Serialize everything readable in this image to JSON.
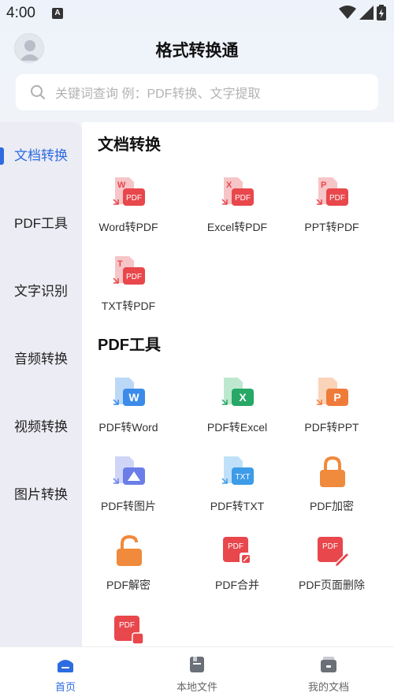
{
  "status_bar": {
    "time": "4:00",
    "notif_letter": "A"
  },
  "header": {
    "title": "格式转换通"
  },
  "search": {
    "placeholder": "关键词查询 例：PDF转换、文字提取"
  },
  "sidebar": {
    "items": [
      {
        "label": "文档转换",
        "active": true
      },
      {
        "label": "PDF工具",
        "active": false
      },
      {
        "label": "文字识别",
        "active": false
      },
      {
        "label": "音频转换",
        "active": false
      },
      {
        "label": "视频转换",
        "active": false
      },
      {
        "label": "图片转换",
        "active": false
      }
    ]
  },
  "sections": [
    {
      "title": "文档转换",
      "tools": [
        {
          "label": "Word转PDF",
          "icon": "word-to-pdf-icon",
          "letter": "W",
          "color": "#e8474c"
        },
        {
          "label": "Excel转PDF",
          "icon": "excel-to-pdf-icon",
          "letter": "X",
          "color": "#e8474c"
        },
        {
          "label": "PPT转PDF",
          "icon": "ppt-to-pdf-icon",
          "letter": "P",
          "color": "#e8474c"
        },
        {
          "label": "TXT转PDF",
          "icon": "txt-to-pdf-icon",
          "letter": "T",
          "color": "#e8474c"
        }
      ]
    },
    {
      "title": "PDF工具",
      "tools": [
        {
          "label": "PDF转Word",
          "icon": "pdf-to-word-icon",
          "letter": "W",
          "color": "#3d8be8"
        },
        {
          "label": "PDF转Excel",
          "icon": "pdf-to-excel-icon",
          "letter": "X",
          "color": "#27a866"
        },
        {
          "label": "PDF转PPT",
          "icon": "pdf-to-ppt-icon",
          "letter": "P",
          "color": "#ef7b3a"
        },
        {
          "label": "PDF转图片",
          "icon": "pdf-to-image-icon",
          "letter": "",
          "color": "#6b7ee8"
        },
        {
          "label": "PDF转TXT",
          "icon": "pdf-to-txt-icon",
          "letter": "TXT",
          "color": "#3d9be8"
        },
        {
          "label": "PDF加密",
          "icon": "pdf-lock-icon",
          "letter": "",
          "color": "#f08a3c"
        },
        {
          "label": "PDF解密",
          "icon": "pdf-unlock-icon",
          "letter": "",
          "color": "#f08a3c"
        },
        {
          "label": "PDF合并",
          "icon": "pdf-merge-icon",
          "letter": "PDF",
          "color": "#e8474c"
        },
        {
          "label": "PDF页面删除",
          "icon": "pdf-page-delete-icon",
          "letter": "PDF",
          "color": "#e8474c"
        },
        {
          "label": "",
          "icon": "pdf-more-icon",
          "letter": "PDF",
          "color": "#e8474c"
        }
      ]
    }
  ],
  "tabbar": {
    "items": [
      {
        "label": "首页",
        "icon": "home-icon",
        "active": true
      },
      {
        "label": "本地文件",
        "icon": "folder-icon",
        "active": false
      },
      {
        "label": "我的文档",
        "icon": "my-docs-icon",
        "active": false
      }
    ]
  },
  "colors": {
    "accent": "#2d6be0",
    "red": "#e8474c",
    "orange": "#f08a3c",
    "green": "#27a866"
  }
}
